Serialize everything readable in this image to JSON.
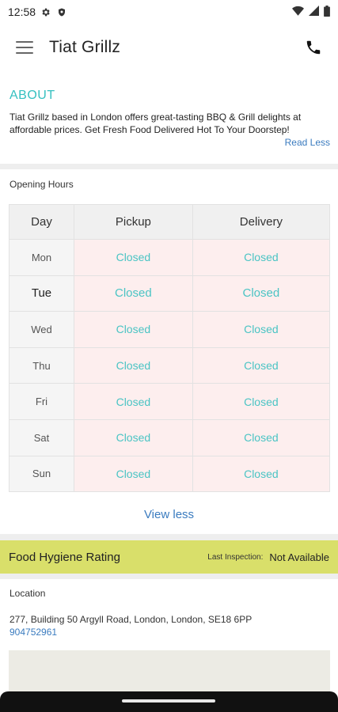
{
  "status_bar": {
    "time": "12:58"
  },
  "app_bar": {
    "title": "Tiat Grillz"
  },
  "about": {
    "heading": "ABOUT",
    "text": "Tiat Grillz based in London offers great-tasting BBQ & Grill delights at affordable prices. Get Fresh Food Delivered Hot To Your Doorstep!",
    "read_less": "Read Less"
  },
  "opening_hours": {
    "title": "Opening Hours",
    "headers": [
      "Day",
      "Pickup",
      "Delivery"
    ],
    "rows": [
      {
        "day": "Mon",
        "pickup": "Closed",
        "delivery": "Closed"
      },
      {
        "day": "Tue",
        "pickup": "Closed",
        "delivery": "Closed"
      },
      {
        "day": "Wed",
        "pickup": "Closed",
        "delivery": "Closed"
      },
      {
        "day": "Thu",
        "pickup": "Closed",
        "delivery": "Closed"
      },
      {
        "day": "Fri",
        "pickup": "Closed",
        "delivery": "Closed"
      },
      {
        "day": "Sat",
        "pickup": "Closed",
        "delivery": "Closed"
      },
      {
        "day": "Sun",
        "pickup": "Closed",
        "delivery": "Closed"
      }
    ],
    "view_less": "View less"
  },
  "hygiene": {
    "label": "Food Hygiene Rating",
    "last_inspection_label": "Last Inspection:",
    "value": "Not Available",
    "color": "#d9df6a"
  },
  "location": {
    "title": "Location",
    "address": "277, Building 50 Argyll Road, London, London, SE18 6PP",
    "phone": "904752961"
  },
  "colors": {
    "accent": "#35c0c0",
    "link": "#3a7bbf",
    "closed_bg": "#fdeeee"
  }
}
